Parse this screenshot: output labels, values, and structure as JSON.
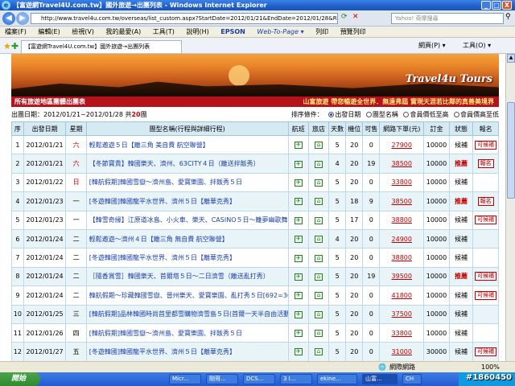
{
  "window": {
    "title": "【富遊網Travel4U.com.tw】國外旅遊→出團列表 - Windows Internet Explorer",
    "min": "_",
    "max": "□",
    "close": "X"
  },
  "address": {
    "url": "http://www.travel4u.com.tw/overseas/list_custom.aspx?StartDate=2012/01/21&EndDate=2012/01/28&ROUT=TPE&day=&&Cou",
    "search_placeholder": "Yahoo! 奇摩搜尋"
  },
  "menu": [
    "檔案(F)",
    "編輯(E)",
    "檢視(V)",
    "我的最愛(A)",
    "工具(T)",
    "說明(H)",
    "EPSON",
    "Web-To-Page ▾",
    "列印",
    "預覽列印"
  ],
  "tab": {
    "label": "【富遊網Travel4U.com.tw】國外旅遊→出團列表",
    "toolbar": [
      "網頁(P) ▾",
      "工具(O) ▾"
    ]
  },
  "banner": {
    "brand": "Travel4u Tours",
    "left": "所有旅遊地區團體出團表",
    "right": "山富旅遊  帶您暢遊全世界．無遠弗屆  實現天涯若比鄰的真善美境界"
  },
  "filter": {
    "date_prefix": "出團日期：2012/01/21~2012/01/28 共",
    "count": "20",
    "date_suffix": "團",
    "sort_label": "排序條件：",
    "sort_options": [
      "出發日期",
      "團型名稱",
      "會員價低至高",
      "會員價高至低"
    ]
  },
  "table": {
    "headers": [
      "序",
      "出發日期",
      "星期",
      "團型名稱(行程與詳細行程)",
      "航班",
      "旅店",
      "天數",
      "機位",
      "可售",
      "網路下單(元)",
      "訂金",
      "狀態",
      "報名"
    ],
    "rows": [
      {
        "no": "1",
        "date": "2012/01/21",
        "wd": "六",
        "name": "輕鬆遨遊５日【離三角 美自費 航空聯營】",
        "days": "5",
        "seats": "20",
        "avail": "0",
        "price": "27900",
        "dep": "10000",
        "status": "候補",
        "apply": "可候補"
      },
      {
        "no": "2",
        "date": "2012/01/21",
        "wd": "六",
        "name": "【冬節寶貴】韓國樂天、濟州、63CITY４日（離送拌飯秀）",
        "days": "4",
        "seats": "20",
        "avail": "19",
        "price": "38500",
        "dep": "10000",
        "status": "推薦",
        "apply": "報名"
      },
      {
        "no": "3",
        "date": "2012/01/22",
        "wd": "日",
        "name": "[韓航假期]韓國雪嶽～濟州島、愛寶樂園、拌飯秀５日",
        "days": "5",
        "seats": "20",
        "avail": "0",
        "price": "33800",
        "dep": "10000",
        "status": "候補",
        "apply": ""
      },
      {
        "no": "4",
        "date": "2012/01/23",
        "wd": "一",
        "name": "[冬遊韓國]韓國龍平水世界、濟州５日【離華克秀】",
        "days": "5",
        "seats": "18",
        "avail": "9",
        "price": "38500",
        "dep": "10000",
        "status": "推薦",
        "apply": "報名"
      },
      {
        "no": "5",
        "date": "2012/01/23",
        "wd": "一",
        "name": "【韓雪奇緣】江原道冰島、小火車、樂天、CASINO５日～離夢幽歌舞秀",
        "days": "5",
        "seats": "17",
        "avail": "0",
        "price": "38800",
        "dep": "10000",
        "status": "候補",
        "apply": "可候補"
      },
      {
        "no": "6",
        "date": "2012/01/24",
        "wd": "二",
        "name": "輕鬆遨遊～濟州４日【離三角 無自費 航空聯營】",
        "days": "4",
        "seats": "20",
        "avail": "0",
        "price": "24900",
        "dep": "10000",
        "status": "候補",
        "apply": ""
      },
      {
        "no": "7",
        "date": "2012/01/24",
        "wd": "二",
        "name": "[冬遊韓國]韓國龍平水世界、濟州５日【離華克秀】",
        "days": "5",
        "seats": "20",
        "avail": "0",
        "price": "38800",
        "dep": "10000",
        "status": "候補",
        "apply": ""
      },
      {
        "no": "8",
        "date": "2012/01/24",
        "wd": "二",
        "name": "［隨香賞雪］韓國樂天、首爾塔５日～二日濟雪（離送亂打秀）",
        "days": "5",
        "seats": "20",
        "avail": "19",
        "price": "39500",
        "dep": "10000",
        "status": "推薦",
        "apply": "可候補"
      },
      {
        "no": "9",
        "date": "2012/01/24",
        "wd": "二",
        "name": "韓航假期～珍藏韓國雪嶽、晉州樂天、愛寶樂園、亂打秀５日[692=3691]",
        "days": "5",
        "seats": "20",
        "avail": "0",
        "price": "41800",
        "dep": "10000",
        "status": "候補",
        "apply": "可候補"
      },
      {
        "no": "10",
        "date": "2012/01/25",
        "wd": "三",
        "name": "[韓航假期]品林韓國時尚首里都雪購物濟雪島５日(首爾一天半自由活動)",
        "days": "5",
        "seats": "20",
        "avail": "0",
        "price": "37500",
        "dep": "10000",
        "status": "候補",
        "apply": ""
      },
      {
        "no": "11",
        "date": "2012/01/26",
        "wd": "四",
        "name": "[韓航假期]韓國雪嶽～濟州島、愛寶樂園、拌飯秀５日",
        "days": "5",
        "seats": "20",
        "avail": "0",
        "price": "33800",
        "dep": "10000",
        "status": "候補",
        "apply": ""
      },
      {
        "no": "12",
        "date": "2012/01/27",
        "wd": "五",
        "name": "[冬遊韓國]韓國龍平水世界、濟州５日【離華克秀】",
        "days": "5",
        "seats": "20",
        "avail": "0",
        "price": "31000",
        "dep": "30000",
        "status": "候補",
        "apply": "可候補"
      },
      {
        "no": "13",
        "date": "2012/01/27",
        "wd": "五",
        "name": "【韓雪奇緣】江原道冰島、小火車、樂天、CASINO５日～離夢幽歌舞秀",
        "days": "5",
        "seats": "20",
        "avail": "0",
        "price": "30500",
        "dep": "5000",
        "status": "候補",
        "apply": "可候補"
      }
    ]
  },
  "statusbar": {
    "zone": "網際網路",
    "zoom": "100%"
  },
  "taskbar": {
    "start": "開始",
    "tasks": [
      "Micr...",
      "剛哥...",
      "DCS...",
      "3 I...",
      "ekine...",
      "山富...",
      "CH"
    ],
    "watermark": "#1860450"
  }
}
